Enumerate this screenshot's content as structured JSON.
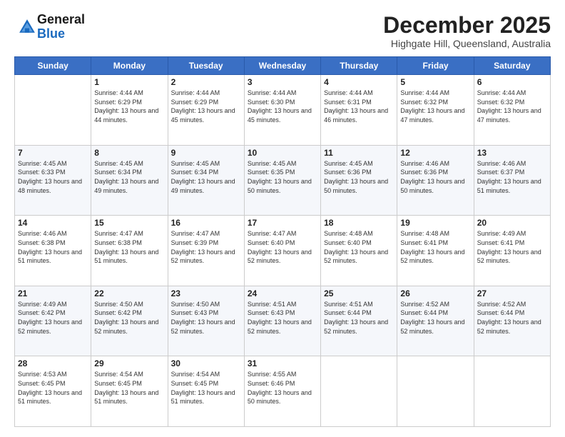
{
  "logo": {
    "line1": "General",
    "line2": "Blue"
  },
  "title": "December 2025",
  "location": "Highgate Hill, Queensland, Australia",
  "days_of_week": [
    "Sunday",
    "Monday",
    "Tuesday",
    "Wednesday",
    "Thursday",
    "Friday",
    "Saturday"
  ],
  "weeks": [
    [
      {
        "date": "",
        "sunrise": "",
        "sunset": "",
        "daylight": ""
      },
      {
        "date": "1",
        "sunrise": "Sunrise: 4:44 AM",
        "sunset": "Sunset: 6:29 PM",
        "daylight": "Daylight: 13 hours and 44 minutes."
      },
      {
        "date": "2",
        "sunrise": "Sunrise: 4:44 AM",
        "sunset": "Sunset: 6:29 PM",
        "daylight": "Daylight: 13 hours and 45 minutes."
      },
      {
        "date": "3",
        "sunrise": "Sunrise: 4:44 AM",
        "sunset": "Sunset: 6:30 PM",
        "daylight": "Daylight: 13 hours and 45 minutes."
      },
      {
        "date": "4",
        "sunrise": "Sunrise: 4:44 AM",
        "sunset": "Sunset: 6:31 PM",
        "daylight": "Daylight: 13 hours and 46 minutes."
      },
      {
        "date": "5",
        "sunrise": "Sunrise: 4:44 AM",
        "sunset": "Sunset: 6:32 PM",
        "daylight": "Daylight: 13 hours and 47 minutes."
      },
      {
        "date": "6",
        "sunrise": "Sunrise: 4:44 AM",
        "sunset": "Sunset: 6:32 PM",
        "daylight": "Daylight: 13 hours and 47 minutes."
      }
    ],
    [
      {
        "date": "7",
        "sunrise": "Sunrise: 4:45 AM",
        "sunset": "Sunset: 6:33 PM",
        "daylight": "Daylight: 13 hours and 48 minutes."
      },
      {
        "date": "8",
        "sunrise": "Sunrise: 4:45 AM",
        "sunset": "Sunset: 6:34 PM",
        "daylight": "Daylight: 13 hours and 49 minutes."
      },
      {
        "date": "9",
        "sunrise": "Sunrise: 4:45 AM",
        "sunset": "Sunset: 6:34 PM",
        "daylight": "Daylight: 13 hours and 49 minutes."
      },
      {
        "date": "10",
        "sunrise": "Sunrise: 4:45 AM",
        "sunset": "Sunset: 6:35 PM",
        "daylight": "Daylight: 13 hours and 50 minutes."
      },
      {
        "date": "11",
        "sunrise": "Sunrise: 4:45 AM",
        "sunset": "Sunset: 6:36 PM",
        "daylight": "Daylight: 13 hours and 50 minutes."
      },
      {
        "date": "12",
        "sunrise": "Sunrise: 4:46 AM",
        "sunset": "Sunset: 6:36 PM",
        "daylight": "Daylight: 13 hours and 50 minutes."
      },
      {
        "date": "13",
        "sunrise": "Sunrise: 4:46 AM",
        "sunset": "Sunset: 6:37 PM",
        "daylight": "Daylight: 13 hours and 51 minutes."
      }
    ],
    [
      {
        "date": "14",
        "sunrise": "Sunrise: 4:46 AM",
        "sunset": "Sunset: 6:38 PM",
        "daylight": "Daylight: 13 hours and 51 minutes."
      },
      {
        "date": "15",
        "sunrise": "Sunrise: 4:47 AM",
        "sunset": "Sunset: 6:38 PM",
        "daylight": "Daylight: 13 hours and 51 minutes."
      },
      {
        "date": "16",
        "sunrise": "Sunrise: 4:47 AM",
        "sunset": "Sunset: 6:39 PM",
        "daylight": "Daylight: 13 hours and 52 minutes."
      },
      {
        "date": "17",
        "sunrise": "Sunrise: 4:47 AM",
        "sunset": "Sunset: 6:40 PM",
        "daylight": "Daylight: 13 hours and 52 minutes."
      },
      {
        "date": "18",
        "sunrise": "Sunrise: 4:48 AM",
        "sunset": "Sunset: 6:40 PM",
        "daylight": "Daylight: 13 hours and 52 minutes."
      },
      {
        "date": "19",
        "sunrise": "Sunrise: 4:48 AM",
        "sunset": "Sunset: 6:41 PM",
        "daylight": "Daylight: 13 hours and 52 minutes."
      },
      {
        "date": "20",
        "sunrise": "Sunrise: 4:49 AM",
        "sunset": "Sunset: 6:41 PM",
        "daylight": "Daylight: 13 hours and 52 minutes."
      }
    ],
    [
      {
        "date": "21",
        "sunrise": "Sunrise: 4:49 AM",
        "sunset": "Sunset: 6:42 PM",
        "daylight": "Daylight: 13 hours and 52 minutes."
      },
      {
        "date": "22",
        "sunrise": "Sunrise: 4:50 AM",
        "sunset": "Sunset: 6:42 PM",
        "daylight": "Daylight: 13 hours and 52 minutes."
      },
      {
        "date": "23",
        "sunrise": "Sunrise: 4:50 AM",
        "sunset": "Sunset: 6:43 PM",
        "daylight": "Daylight: 13 hours and 52 minutes."
      },
      {
        "date": "24",
        "sunrise": "Sunrise: 4:51 AM",
        "sunset": "Sunset: 6:43 PM",
        "daylight": "Daylight: 13 hours and 52 minutes."
      },
      {
        "date": "25",
        "sunrise": "Sunrise: 4:51 AM",
        "sunset": "Sunset: 6:44 PM",
        "daylight": "Daylight: 13 hours and 52 minutes."
      },
      {
        "date": "26",
        "sunrise": "Sunrise: 4:52 AM",
        "sunset": "Sunset: 6:44 PM",
        "daylight": "Daylight: 13 hours and 52 minutes."
      },
      {
        "date": "27",
        "sunrise": "Sunrise: 4:52 AM",
        "sunset": "Sunset: 6:44 PM",
        "daylight": "Daylight: 13 hours and 52 minutes."
      }
    ],
    [
      {
        "date": "28",
        "sunrise": "Sunrise: 4:53 AM",
        "sunset": "Sunset: 6:45 PM",
        "daylight": "Daylight: 13 hours and 51 minutes."
      },
      {
        "date": "29",
        "sunrise": "Sunrise: 4:54 AM",
        "sunset": "Sunset: 6:45 PM",
        "daylight": "Daylight: 13 hours and 51 minutes."
      },
      {
        "date": "30",
        "sunrise": "Sunrise: 4:54 AM",
        "sunset": "Sunset: 6:45 PM",
        "daylight": "Daylight: 13 hours and 51 minutes."
      },
      {
        "date": "31",
        "sunrise": "Sunrise: 4:55 AM",
        "sunset": "Sunset: 6:46 PM",
        "daylight": "Daylight: 13 hours and 50 minutes."
      },
      {
        "date": "",
        "sunrise": "",
        "sunset": "",
        "daylight": ""
      },
      {
        "date": "",
        "sunrise": "",
        "sunset": "",
        "daylight": ""
      },
      {
        "date": "",
        "sunrise": "",
        "sunset": "",
        "daylight": ""
      }
    ]
  ]
}
